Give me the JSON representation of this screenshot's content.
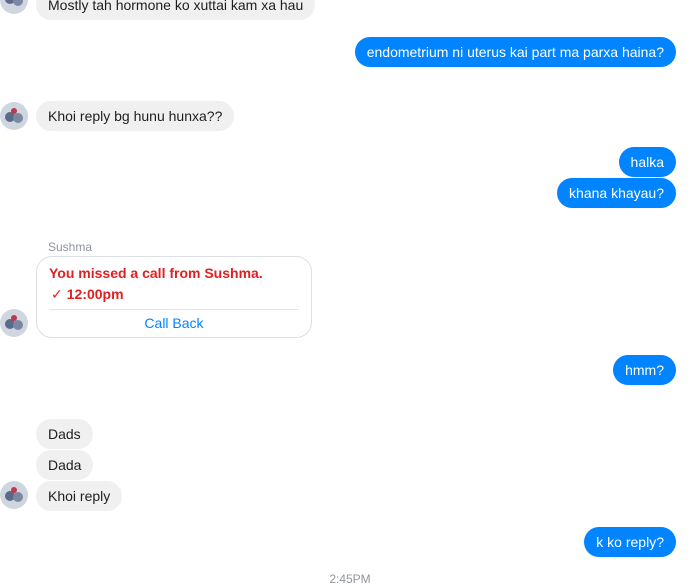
{
  "messages": {
    "m1": "Mostly tah hormone  ko xuttai kam xa hau",
    "m2": "endometrium ni uterus kai part ma parxa haina?",
    "m3": "Khoi reply bg hunu hunxa??",
    "m4": "halka",
    "m5": "khana khayau?",
    "m6": "hmm?",
    "m7": "Dads",
    "m8": "Dada",
    "m9": "Khoi reply",
    "m10": "k ko reply?"
  },
  "call": {
    "sender": "Sushma",
    "title": "You missed a call from Sushma.",
    "check_icon": "✓",
    "time": "12:00pm",
    "action": "Call Back"
  },
  "timestamp": "2:45PM",
  "colors": {
    "outgoing": "#0084ff",
    "incoming": "#f1f0f0",
    "missed": "#e02020"
  }
}
